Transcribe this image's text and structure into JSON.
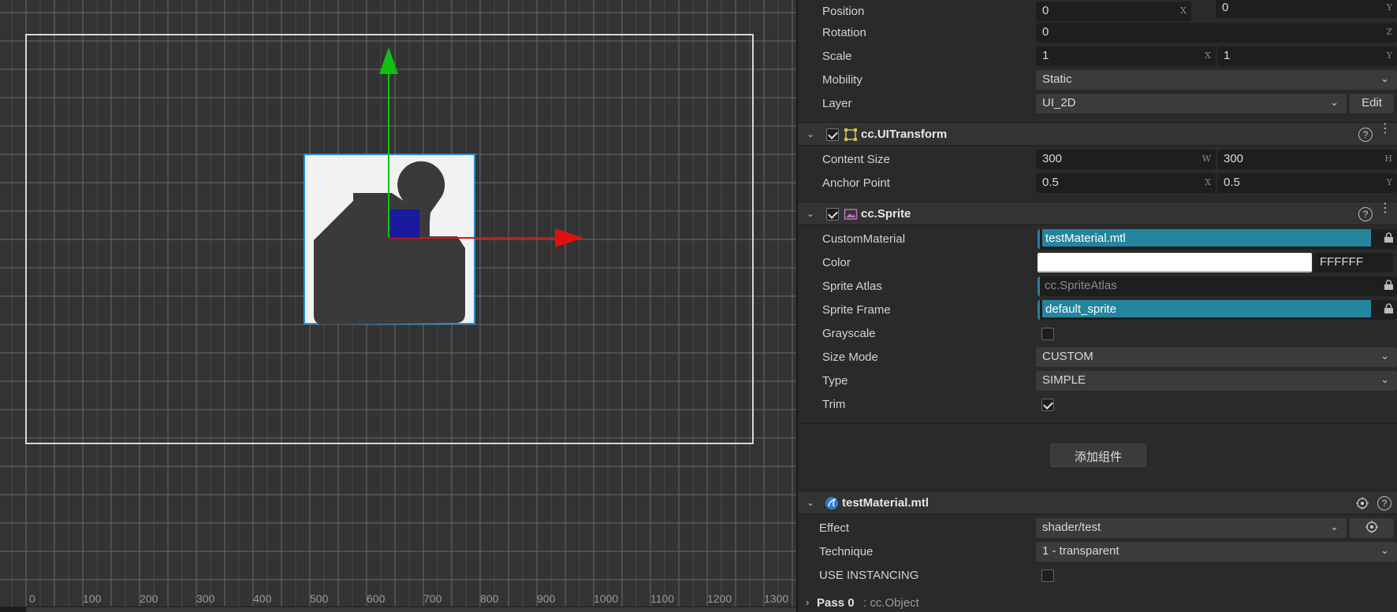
{
  "scene": {
    "ruler_labels": [
      "0",
      "100",
      "200",
      "300",
      "400",
      "500",
      "600",
      "700",
      "800",
      "900",
      "1000",
      "1100",
      "1200",
      "1300"
    ]
  },
  "node": {
    "position": {
      "label": "Position",
      "x": "0",
      "y": "0",
      "x_axis": "X",
      "y_axis": "Y"
    },
    "rotation": {
      "label": "Rotation",
      "value": "0",
      "axis": "Z"
    },
    "scale": {
      "label": "Scale",
      "x": "1",
      "y": "1",
      "x_axis": "X",
      "y_axis": "Y"
    },
    "mobility": {
      "label": "Mobility",
      "value": "Static"
    },
    "layer": {
      "label": "Layer",
      "value": "UI_2D",
      "edit_label": "Edit"
    }
  },
  "ui_transform": {
    "title": "cc.UITransform",
    "content_size": {
      "label": "Content Size",
      "w": "300",
      "h": "300",
      "w_axis": "W",
      "h_axis": "H"
    },
    "anchor_point": {
      "label": "Anchor Point",
      "x": "0.5",
      "y": "0.5",
      "x_axis": "X",
      "y_axis": "Y"
    }
  },
  "sprite": {
    "title": "cc.Sprite",
    "custom_material": {
      "label": "CustomMaterial",
      "value": "testMaterial.mtl"
    },
    "color": {
      "label": "Color",
      "hex": "FFFFFF",
      "swatch": "#ffffff"
    },
    "sprite_atlas": {
      "label": "Sprite Atlas",
      "value": "cc.SpriteAtlas"
    },
    "sprite_frame": {
      "label": "Sprite Frame",
      "value": "default_sprite"
    },
    "grayscale": {
      "label": "Grayscale",
      "checked": false
    },
    "size_mode": {
      "label": "Size Mode",
      "value": "CUSTOM"
    },
    "type": {
      "label": "Type",
      "value": "SIMPLE"
    },
    "trim": {
      "label": "Trim",
      "checked": true
    }
  },
  "add_component_label": "添加组件",
  "material": {
    "title": "testMaterial.mtl",
    "effect": {
      "label": "Effect",
      "value": "shader/test"
    },
    "technique": {
      "label": "Technique",
      "value": "1 - transparent"
    },
    "use_instancing": {
      "label": "USE INSTANCING",
      "checked": false
    },
    "pass": {
      "label": "Pass 0",
      "type": ": cc.Object"
    }
  },
  "colors": {
    "accent": "#24859f",
    "x_axis": "#e01010",
    "y_axis": "#10c010",
    "z_axis": "#1a1aa0"
  },
  "help_symbol": "?"
}
